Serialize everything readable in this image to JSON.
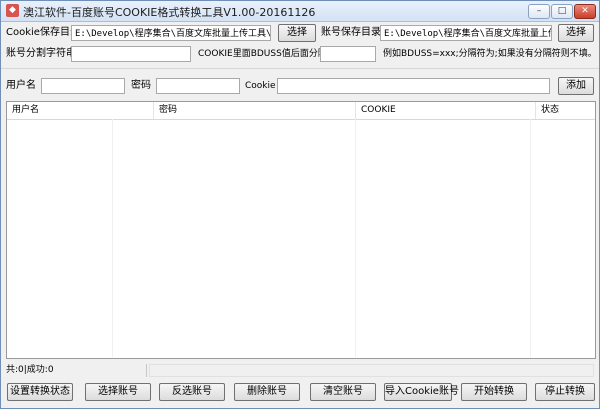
{
  "window": {
    "title": "澳江软件-百度账号COOKIE格式转换工具V1.00-20161126",
    "controls": {
      "minimize": "–",
      "maximize": "□",
      "close": "✕"
    }
  },
  "paths": {
    "cookie_dir_label": "Cookie保存目录",
    "cookie_dir_value": "E:\\Develop\\程序集合\\百度文库批量上传工具\\Data",
    "cookie_dir_button": "选择",
    "account_dir_label": "账号保存目录",
    "account_dir_value": "E:\\Develop\\程序集合\\百度文库批量上传工具",
    "account_dir_button": "选择"
  },
  "separators": {
    "account_sep_label": "账号分割字符串",
    "account_sep_value": "",
    "bduss_sep_label": "COOKIE里面BDUSS值后面分隔符",
    "bduss_sep_value": "",
    "bduss_hint": "例如BDUSS=xxx;分隔符为;如果没有分隔符则不填。"
  },
  "add_row": {
    "username_label": "用户名",
    "username_value": "",
    "password_label": "密码",
    "password_value": "",
    "cookie_label": "Cookie",
    "cookie_value": "",
    "add_button": "添加"
  },
  "table": {
    "columns": [
      "用户名",
      "密码",
      "COOKIE",
      "状态"
    ],
    "rows": []
  },
  "status": {
    "summary": "共:0|成功:0",
    "message": ""
  },
  "actions": {
    "set_status": "设置转换状态",
    "select_accounts": "选择账号",
    "invert_selection": "反选账号",
    "delete_accounts": "删除账号",
    "clear_accounts": "清空账号",
    "import_cookie": "导入Cookie账号",
    "start_convert": "开始转换",
    "stop_convert": "停止转换"
  }
}
